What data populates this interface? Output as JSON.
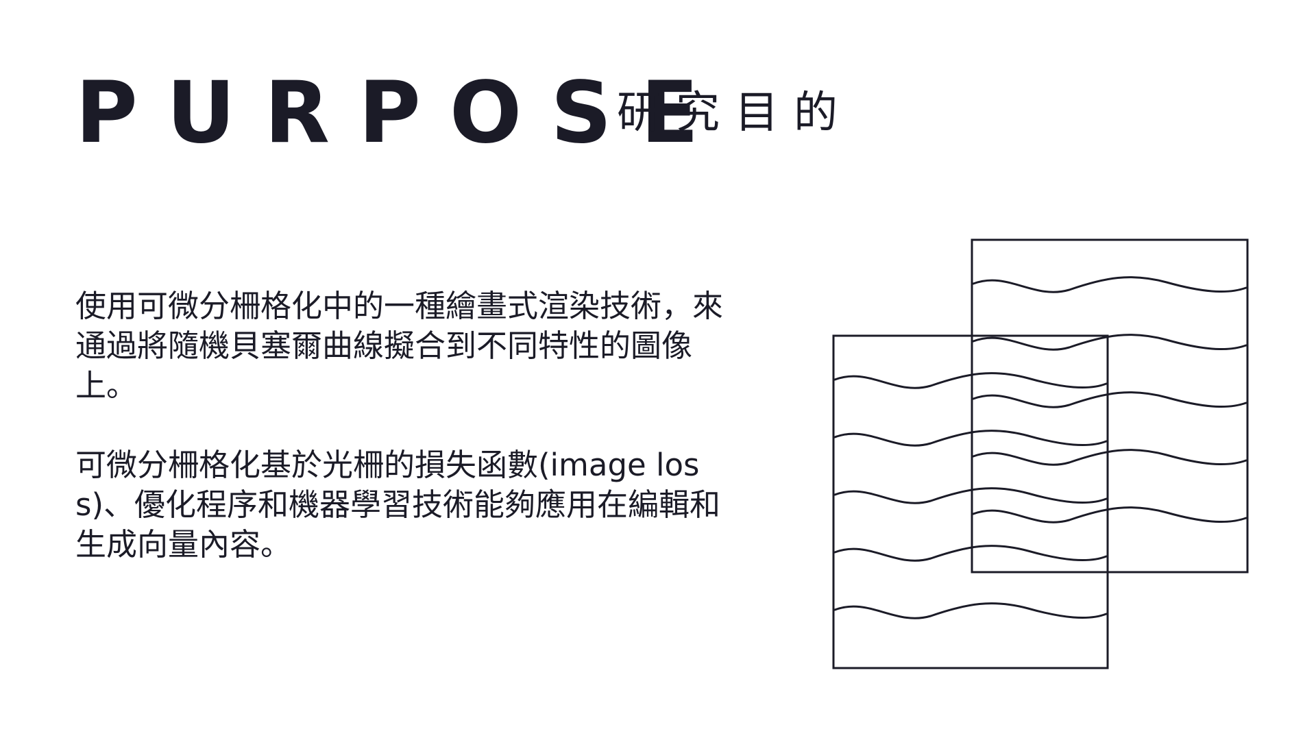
{
  "title": {
    "en": "PURPOSE",
    "zh": "研究目的"
  },
  "body": {
    "paragraph_1": "使用可微分柵格化中的一種繪畫式渲染技術，來通過將隨機貝塞爾曲線擬合到不同特性的圖像上。",
    "paragraph_2": "可微分柵格化基於光柵的損失函數(image loss)、優化程序和機器學習技術能夠應用在編輯和生成向量內容。"
  },
  "colors": {
    "text": "#1b1b27",
    "stroke": "#1b1b27",
    "background": "#ffffff"
  },
  "illustration": {
    "icon": "overlapping-wavy-line-sheets-icon"
  }
}
